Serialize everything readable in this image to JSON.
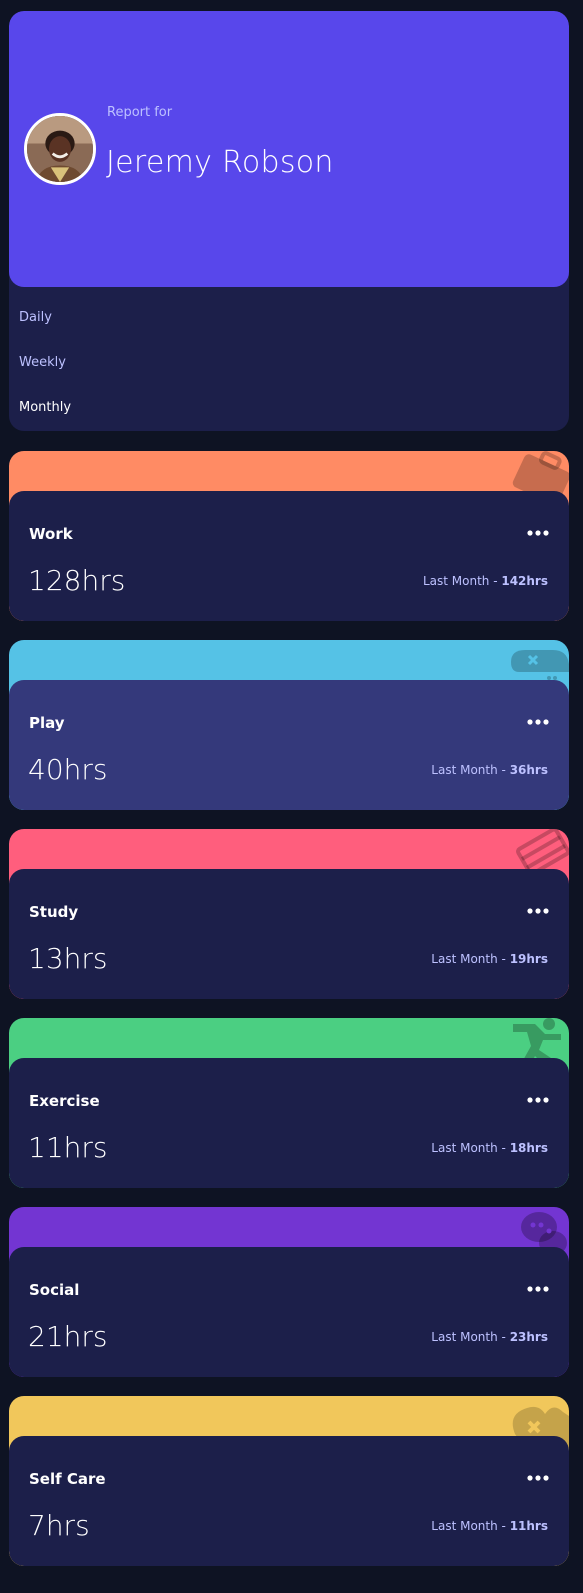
{
  "profile": {
    "report_label": "Report for",
    "name": "Jeremy Robson",
    "avatar_icon": "user-avatar-photo"
  },
  "timeframes": {
    "options": [
      "Daily",
      "Weekly",
      "Monthly"
    ],
    "selected": "Monthly"
  },
  "activities": [
    {
      "title": "Work",
      "current": "128hrs",
      "prev_prefix": "Last Month - ",
      "prev_value": "142hrs",
      "color": "#ff8b64",
      "icon": "briefcase-icon"
    },
    {
      "title": "Play",
      "current": "40hrs",
      "prev_prefix": "Last Month - ",
      "prev_value": "36hrs",
      "color": "#55c2e6",
      "icon": "gamepad-icon"
    },
    {
      "title": "Study",
      "current": "13hrs",
      "prev_prefix": "Last Month - ",
      "prev_value": "19hrs",
      "color": "#ff5e7d",
      "icon": "book-icon"
    },
    {
      "title": "Exercise",
      "current": "11hrs",
      "prev_prefix": "Last Month - ",
      "prev_value": "18hrs",
      "color": "#4bcf82",
      "icon": "running-icon"
    },
    {
      "title": "Social",
      "current": "21hrs",
      "prev_prefix": "Last Month - ",
      "prev_value": "23hrs",
      "color": "#7335d2",
      "icon": "chat-icon"
    },
    {
      "title": "Self Care",
      "current": "7hrs",
      "prev_prefix": "Last Month - ",
      "prev_value": "11hrs",
      "color": "#f1c75b",
      "icon": "heart-care-icon"
    }
  ],
  "colors": {
    "background": "#0e1323",
    "card": "#1c1f4a",
    "card_hover": "#34397b",
    "accent": "#5847eb",
    "muted_text": "#bdc1ff"
  }
}
